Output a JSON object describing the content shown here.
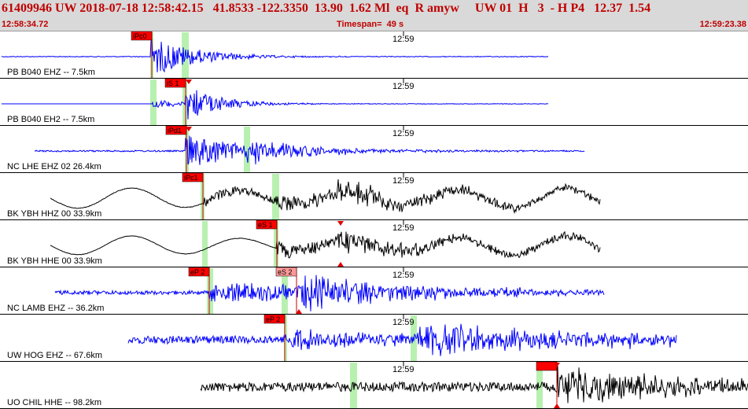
{
  "header": {
    "info_line": "61409946 UW 2018-07-18 12:58:42.15   41.8533 -122.3350  13.90  1.62 Ml  eq  R amyw     UW 01  H   3  - H P4   12.37  1.54",
    "start_time": "12:58:34.72",
    "timespan": "Timespan=  49 s",
    "end_time": "12:59:23.38"
  },
  "colors": {
    "blue_trace": "#0000ff",
    "black_trace": "#000000",
    "pick_flag": "#ff0000",
    "pick_flag_light": "#ff9999",
    "window_band": "#b8f0b0",
    "divider": "#000000",
    "label_text": "#000000"
  },
  "minute_mark": "12:59",
  "channels": [
    {
      "label": "PB B040 EHZ -- 7.5km",
      "color": "blue",
      "pick": "iPc0",
      "pick_style": "red"
    },
    {
      "label": "PB B040 EH2 -- 7.5km",
      "color": "blue",
      "pick": "iS 1",
      "pick_style": "red"
    },
    {
      "label": "NC LHE EHZ 02 26.4km",
      "color": "blue",
      "pick": "iPd1",
      "pick_style": "red"
    },
    {
      "label": "BK YBH HHZ 00 33.9km",
      "color": "black",
      "pick": "iPc1",
      "pick_style": "red"
    },
    {
      "label": "BK YBH HHE 00 33.9km",
      "color": "black",
      "pick": "eS 1",
      "pick_style": "red"
    },
    {
      "label": "NC LAMB EHZ -- 36.2km",
      "color": "blue",
      "pick": "eP 2",
      "pick_style": "red",
      "pick2": "eS 2",
      "pick2_style": "light"
    },
    {
      "label": "UW HOG EHZ -- 67.6km",
      "color": "blue",
      "pick": "eP 2",
      "pick_style": "red"
    },
    {
      "label": "UO CHIL HHE -- 98.2km",
      "color": "black",
      "pick": "eS 2",
      "pick_style": "light"
    }
  ]
}
